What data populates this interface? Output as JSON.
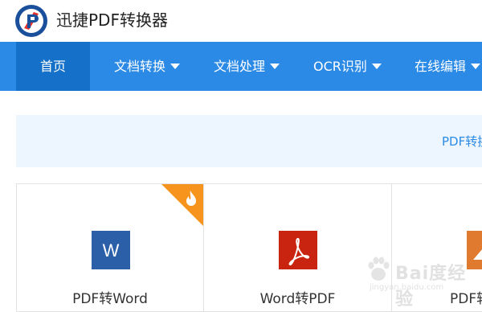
{
  "app": {
    "title": "迅捷PDF转换器"
  },
  "nav": {
    "items": [
      {
        "label": "首页",
        "active": true,
        "has_dropdown": false
      },
      {
        "label": "文档转换",
        "active": false,
        "has_dropdown": true
      },
      {
        "label": "文档处理",
        "active": false,
        "has_dropdown": true
      },
      {
        "label": "OCR识别",
        "active": false,
        "has_dropdown": true
      },
      {
        "label": "在线编辑",
        "active": false,
        "has_dropdown": true
      }
    ]
  },
  "banner": {
    "text": "PDF转换"
  },
  "cards": [
    {
      "label": "PDF转Word",
      "icon": "word-icon",
      "icon_color": "#2b5fa8",
      "hot": true
    },
    {
      "label": "Word转PDF",
      "icon": "pdf-icon",
      "icon_color": "#c9240f",
      "hot": false
    },
    {
      "label": "PDF转",
      "icon": "image-icon",
      "icon_color": "#e07a2e",
      "hot": false
    }
  ],
  "colors": {
    "nav_background": "#2b8ae6",
    "nav_active": "#1470c8",
    "banner_background": "#edf6fe",
    "hot_badge": "#f7941d"
  },
  "watermark": {
    "text": "Bai度经验",
    "url": "jingyan.baidu.com"
  }
}
